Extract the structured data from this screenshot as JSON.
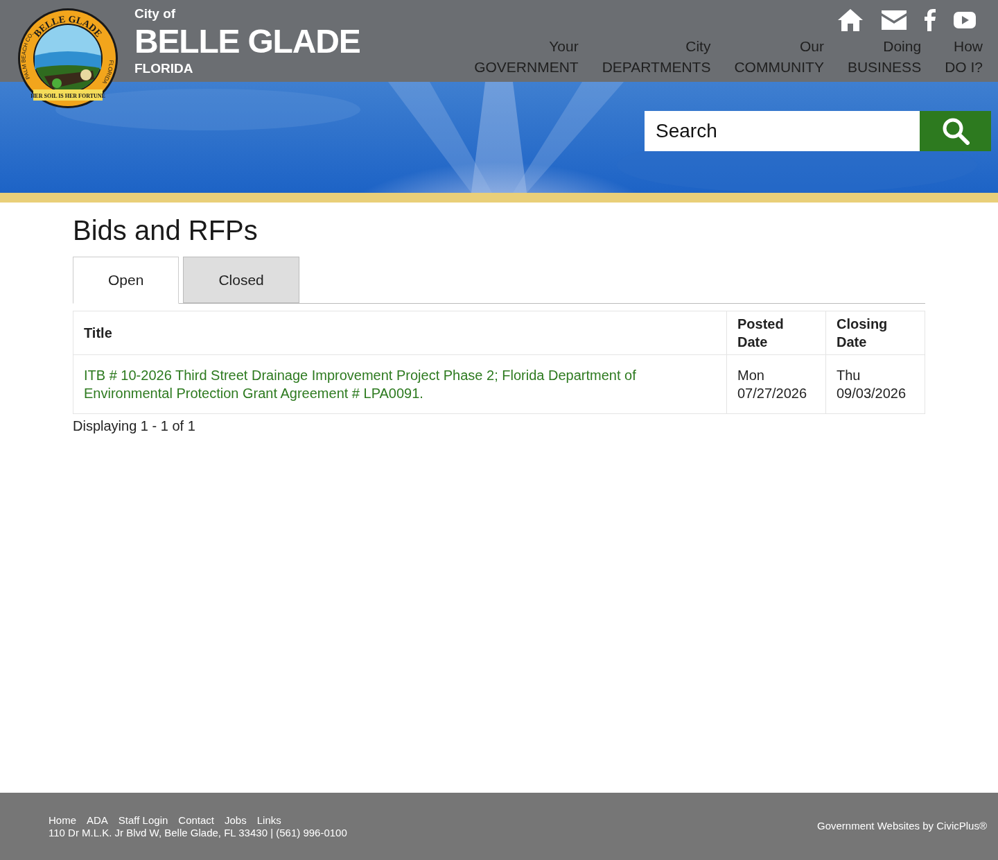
{
  "seal": {
    "top_text": "BELLE GLADE",
    "left_text": "PALM BEACH CO.",
    "right_text": "FLORIDA",
    "motto": "HER SOIL IS HER FORTUNE"
  },
  "site": {
    "prefix": "City of",
    "name": "BELLE GLADE",
    "state": "FLORIDA"
  },
  "nav": [
    {
      "line1": "Your",
      "line2": "GOVERNMENT"
    },
    {
      "line1": "City",
      "line2": "DEPARTMENTS"
    },
    {
      "line1": "Our",
      "line2": "COMMUNITY"
    },
    {
      "line1": "Doing",
      "line2": "BUSINESS"
    },
    {
      "line1": "How",
      "line2": "DO I?"
    }
  ],
  "social": [
    {
      "kind": "home"
    },
    {
      "kind": "mail"
    },
    {
      "kind": "facebook"
    },
    {
      "kind": "youtube"
    }
  ],
  "search": {
    "placeholder": "Search"
  },
  "page": {
    "title": "Bids and RFPs"
  },
  "tabs": [
    {
      "label": "Open",
      "selected": true
    },
    {
      "label": "Closed",
      "selected": false
    }
  ],
  "table": {
    "columns": [
      {
        "line1": "Title"
      },
      {
        "line1": "Posted",
        "line2": "Date"
      },
      {
        "line1": "Closing",
        "line2": "Date"
      }
    ],
    "rows": [
      {
        "title": "ITB # 10-2026 Third Street Drainage Improvement Project Phase 2; Florida Department of Environmental Protection Grant Agreement # LPA0091.",
        "posted_day": "Mon",
        "posted_date": "07/27/2026",
        "closing_day": "Thu",
        "closing_date": "09/03/2026"
      }
    ]
  },
  "pagination": "Displaying 1 - 1 of 1",
  "footer": {
    "links": [
      "Home",
      "ADA",
      "Staff Login",
      "Contact",
      "Jobs",
      "Links"
    ],
    "address": "110 Dr M.L.K. Jr Blvd W, Belle Glade, FL 33430 | (561) 996-0100",
    "credit": "Government Websites by CivicPlus®"
  }
}
